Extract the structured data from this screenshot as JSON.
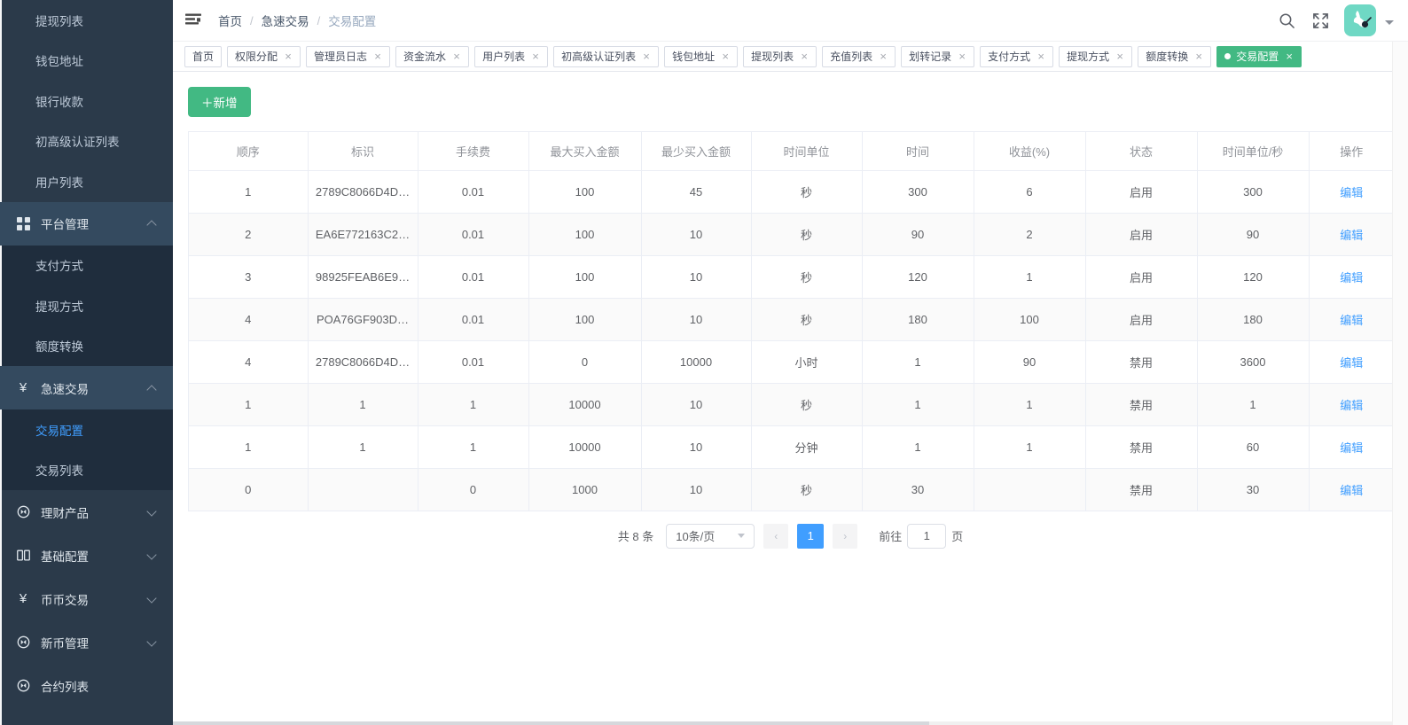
{
  "sidebar": {
    "items": [
      {
        "label": "提现列表",
        "type": "sub",
        "active": false
      },
      {
        "label": "钱包地址",
        "type": "sub",
        "active": false
      },
      {
        "label": "银行收款",
        "type": "sub",
        "active": false
      },
      {
        "label": "初高级认证列表",
        "type": "sub",
        "active": false
      },
      {
        "label": "用户列表",
        "type": "sub",
        "active": false
      }
    ],
    "group_platform": {
      "label": "平台管理",
      "icon": "grid-icon",
      "expanded": true,
      "chevron": "chevron-up-icon"
    },
    "platform_children": [
      {
        "label": "支付方式"
      },
      {
        "label": "提现方式"
      },
      {
        "label": "额度转换"
      }
    ],
    "group_fast": {
      "label": "急速交易",
      "icon": "yen-icon",
      "expanded": true,
      "chevron": "chevron-up-icon"
    },
    "fast_children": [
      {
        "label": "交易配置",
        "active": true
      },
      {
        "label": "交易列表",
        "active": false
      }
    ],
    "groups_collapsed": [
      {
        "label": "理财产品",
        "icon": "coin-icon",
        "chevron": "chevron-down-icon"
      },
      {
        "label": "基础配置",
        "icon": "book-icon",
        "chevron": "chevron-down-icon"
      },
      {
        "label": "币币交易",
        "icon": "yen-icon",
        "chevron": "chevron-down-icon"
      },
      {
        "label": "新币管理",
        "icon": "coin-icon",
        "chevron": "chevron-down-icon"
      },
      {
        "label": "合约列表",
        "icon": "coin-icon",
        "chevron": ""
      }
    ]
  },
  "navbar": {
    "hamburger_icon": "menu-collapse-icon",
    "breadcrumb": [
      "首页",
      "急速交易",
      "交易配置"
    ],
    "separator": "/",
    "search_icon": "search-icon",
    "fullscreen_icon": "fullscreen-icon",
    "avatar_icon": "user-avatar",
    "caret_icon": "caret-down-icon",
    "avatar_color": "#6fd8c4"
  },
  "tags": [
    {
      "label": "首页",
      "closable": false,
      "active": false
    },
    {
      "label": "权限分配",
      "closable": true,
      "active": false
    },
    {
      "label": "管理员日志",
      "closable": true,
      "active": false
    },
    {
      "label": "资金流水",
      "closable": true,
      "active": false
    },
    {
      "label": "用户列表",
      "closable": true,
      "active": false
    },
    {
      "label": "初高级认证列表",
      "closable": true,
      "active": false
    },
    {
      "label": "钱包地址",
      "closable": true,
      "active": false
    },
    {
      "label": "提现列表",
      "closable": true,
      "active": false
    },
    {
      "label": "充值列表",
      "closable": true,
      "active": false
    },
    {
      "label": "划转记录",
      "closable": true,
      "active": false
    },
    {
      "label": "支付方式",
      "closable": true,
      "active": false
    },
    {
      "label": "提现方式",
      "closable": true,
      "active": false
    },
    {
      "label": "额度转换",
      "closable": true,
      "active": false
    },
    {
      "label": "交易配置",
      "closable": true,
      "active": true
    }
  ],
  "toolbar": {
    "add_label": "＋新增",
    "add_color": "#42b983"
  },
  "table": {
    "columns": [
      "顺序",
      "标识",
      "手续费",
      "最大买入金额",
      "最少买入金额",
      "时间单位",
      "时间",
      "收益(%)",
      "状态",
      "时间单位/秒",
      "操作"
    ],
    "action_label": "编辑",
    "rows": [
      {
        "order": "1",
        "ident": "2789C8066D4D…",
        "fee": "0.01",
        "max_buy": "100",
        "min_buy": "45",
        "unit": "秒",
        "time": "300",
        "profit": "6",
        "status": "启用",
        "status_on": true,
        "unit_sec": "300"
      },
      {
        "order": "2",
        "ident": "EA6E772163C2…",
        "fee": "0.01",
        "max_buy": "100",
        "min_buy": "10",
        "unit": "秒",
        "time": "90",
        "profit": "2",
        "status": "启用",
        "status_on": true,
        "unit_sec": "90"
      },
      {
        "order": "3",
        "ident": "98925FEAB6E9…",
        "fee": "0.01",
        "max_buy": "100",
        "min_buy": "10",
        "unit": "秒",
        "time": "120",
        "profit": "1",
        "status": "启用",
        "status_on": true,
        "unit_sec": "120"
      },
      {
        "order": "4",
        "ident": "POA76GF903D…",
        "fee": "0.01",
        "max_buy": "100",
        "min_buy": "10",
        "unit": "秒",
        "time": "180",
        "profit": "100",
        "status": "启用",
        "status_on": true,
        "unit_sec": "180"
      },
      {
        "order": "4",
        "ident": "2789C8066D4D…",
        "fee": "0.01",
        "max_buy": "0",
        "min_buy": "10000",
        "unit": "小时",
        "time": "1",
        "profit": "90",
        "status": "禁用",
        "status_on": false,
        "unit_sec": "3600"
      },
      {
        "order": "1",
        "ident": "1",
        "fee": "1",
        "max_buy": "10000",
        "min_buy": "10",
        "unit": "秒",
        "time": "1",
        "profit": "1",
        "status": "禁用",
        "status_on": false,
        "unit_sec": "1"
      },
      {
        "order": "1",
        "ident": "1",
        "fee": "1",
        "max_buy": "10000",
        "min_buy": "10",
        "unit": "分钟",
        "time": "1",
        "profit": "1",
        "status": "禁用",
        "status_on": false,
        "unit_sec": "60"
      },
      {
        "order": "0",
        "ident": "",
        "fee": "0",
        "max_buy": "1000",
        "min_buy": "10",
        "unit": "秒",
        "time": "30",
        "profit": "",
        "status": "禁用",
        "status_on": false,
        "unit_sec": "30"
      }
    ]
  },
  "pagination": {
    "total_label": "共 8 条",
    "page_size": "10条/页",
    "prev": "‹",
    "next": "›",
    "pages": [
      "1"
    ],
    "current_page": "1",
    "jump_prefix": "前往",
    "jump_value": "1",
    "jump_suffix": "页",
    "active_color": "#409eff"
  }
}
